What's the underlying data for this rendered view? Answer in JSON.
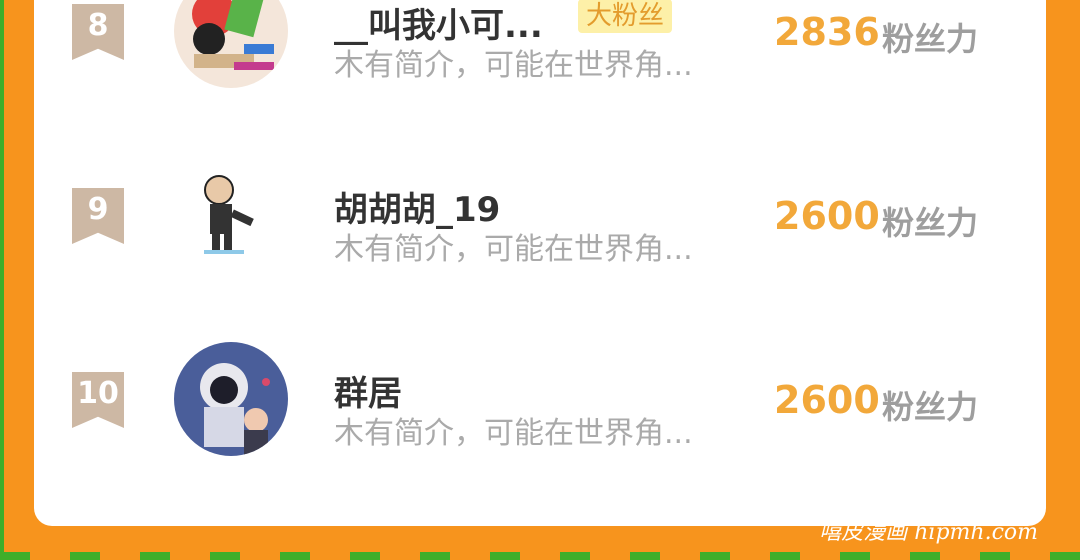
{
  "ranking": [
    {
      "rank": "8",
      "name": "__叫我小可...",
      "badge": "大粉丝",
      "intro": "木有简介，可能在世界角...",
      "score": "2836",
      "score_unit": "粉丝力",
      "avatar_icon": "cartoon-avatar-icon"
    },
    {
      "rank": "9",
      "name": "胡胡胡_19",
      "badge": "",
      "intro": "木有简介，可能在世界角...",
      "score": "2600",
      "score_unit": "粉丝力",
      "avatar_icon": "bald-man-sketch-avatar-icon"
    },
    {
      "rank": "10",
      "name": "群居",
      "badge": "",
      "intro": "木有简介，可能在世界角...",
      "score": "2600",
      "score_unit": "粉丝力",
      "avatar_icon": "anime-figures-avatar-icon"
    }
  ],
  "watermark": "嘻皮漫画 hipmh.com",
  "colors": {
    "background": "#f7941d",
    "score": "#f2a83a",
    "rank_badge": "#cdb8a4"
  }
}
